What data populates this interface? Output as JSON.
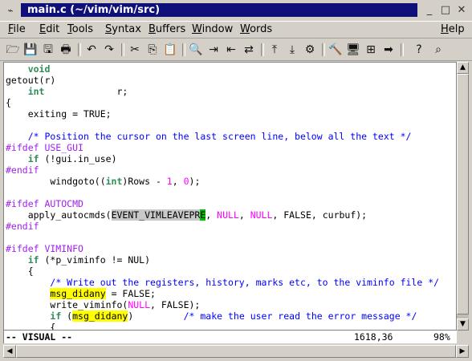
{
  "window": {
    "title": "main.c (~/vim/vim/src)",
    "app_icon": "vim-icon",
    "minimize_glyph": "_",
    "maximize_glyph": "□",
    "close_glyph": "✕"
  },
  "menubar": {
    "items": [
      "File",
      "Edit",
      "Tools",
      "Syntax",
      "Buffers",
      "Window",
      "Words",
      "Help"
    ]
  },
  "toolbar": {
    "icons": [
      "open-icon",
      "save-icon",
      "save-all-icon",
      "print-icon",
      "undo-icon",
      "redo-icon",
      "cut-icon",
      "copy-icon",
      "paste-icon",
      "find-icon",
      "find-next-icon",
      "find-prev-icon",
      "replace-icon",
      "load-session-icon",
      "save-session-icon",
      "run-script-icon",
      "make-icon",
      "shell-icon",
      "ctags-icon",
      "tag-jump-icon",
      "help-icon",
      "find-help-icon"
    ],
    "glyphs": [
      "🗁",
      "💾",
      "🖫",
      "🖶",
      "↶",
      "↷",
      "✂",
      "⎘",
      "📋",
      "🔍",
      "⇥",
      "⇤",
      "⇄",
      "⤒",
      "⤓",
      "⚙",
      "🔨",
      "🖥",
      "⊞",
      "➡",
      "?",
      "⌕"
    ]
  },
  "editor": {
    "lines": [
      [
        {
          "t": "    "
        },
        {
          "t": "void",
          "c": "k"
        }
      ],
      [
        {
          "t": "getout(r)"
        }
      ],
      [
        {
          "t": "    "
        },
        {
          "t": "int",
          "c": "k"
        },
        {
          "t": "             r;"
        }
      ],
      [
        {
          "t": "{"
        }
      ],
      [
        {
          "t": "    exiting = TRUE;"
        }
      ],
      [
        {
          "t": ""
        }
      ],
      [
        {
          "t": "    "
        },
        {
          "t": "/* Position the cursor on the last screen line, below all the text */",
          "c": "c"
        }
      ],
      [
        {
          "t": "#ifdef USE_GUI",
          "c": "p"
        }
      ],
      [
        {
          "t": "    "
        },
        {
          "t": "if",
          "c": "k"
        },
        {
          "t": " (!gui.in_use)"
        }
      ],
      [
        {
          "t": "#endif",
          "c": "p"
        }
      ],
      [
        {
          "t": "        windgoto(("
        },
        {
          "t": "int",
          "c": "k"
        },
        {
          "t": ")Rows - "
        },
        {
          "t": "1",
          "c": "n"
        },
        {
          "t": ", "
        },
        {
          "t": "0",
          "c": "n"
        },
        {
          "t": ");"
        }
      ],
      [
        {
          "t": ""
        }
      ],
      [
        {
          "t": "#ifdef AUTOCMD",
          "c": "p"
        }
      ],
      [
        {
          "t": "    apply_autocmds("
        },
        {
          "t": "EVENT_VIMLEAVEPR",
          "c": "vis"
        },
        {
          "t": "E",
          "c": "cur"
        },
        {
          "t": ", "
        },
        {
          "t": "NULL",
          "c": "n"
        },
        {
          "t": ", "
        },
        {
          "t": "NULL",
          "c": "n"
        },
        {
          "t": ", FALSE, curbuf);"
        }
      ],
      [
        {
          "t": "#endif",
          "c": "p"
        }
      ],
      [
        {
          "t": ""
        }
      ],
      [
        {
          "t": "#ifdef VIMINFO",
          "c": "p"
        }
      ],
      [
        {
          "t": "    "
        },
        {
          "t": "if",
          "c": "k"
        },
        {
          "t": " (*p_viminfo != NUL)"
        }
      ],
      [
        {
          "t": "    {"
        }
      ],
      [
        {
          "t": "        "
        },
        {
          "t": "/* Write out the registers, history, marks etc, to the viminfo file */",
          "c": "c"
        }
      ],
      [
        {
          "t": "        "
        },
        {
          "t": "msg_didany",
          "c": "hl"
        },
        {
          "t": " = FALSE;"
        }
      ],
      [
        {
          "t": "        write_viminfo("
        },
        {
          "t": "NULL",
          "c": "n"
        },
        {
          "t": ", FALSE);"
        }
      ],
      [
        {
          "t": "        "
        },
        {
          "t": "if",
          "c": "k"
        },
        {
          "t": " ("
        },
        {
          "t": "msg_didany",
          "c": "hl"
        },
        {
          "t": ")         "
        },
        {
          "t": "/* make the user read the error message */",
          "c": "c"
        }
      ],
      [
        {
          "t": "        {"
        }
      ]
    ]
  },
  "statusline": {
    "mode": "-- VISUAL --",
    "position": "1618,36",
    "percent": "98%"
  },
  "scrollbar": {
    "up_glyph": "▲",
    "down_glyph": "▼",
    "left_glyph": "◀",
    "right_glyph": "▶"
  }
}
